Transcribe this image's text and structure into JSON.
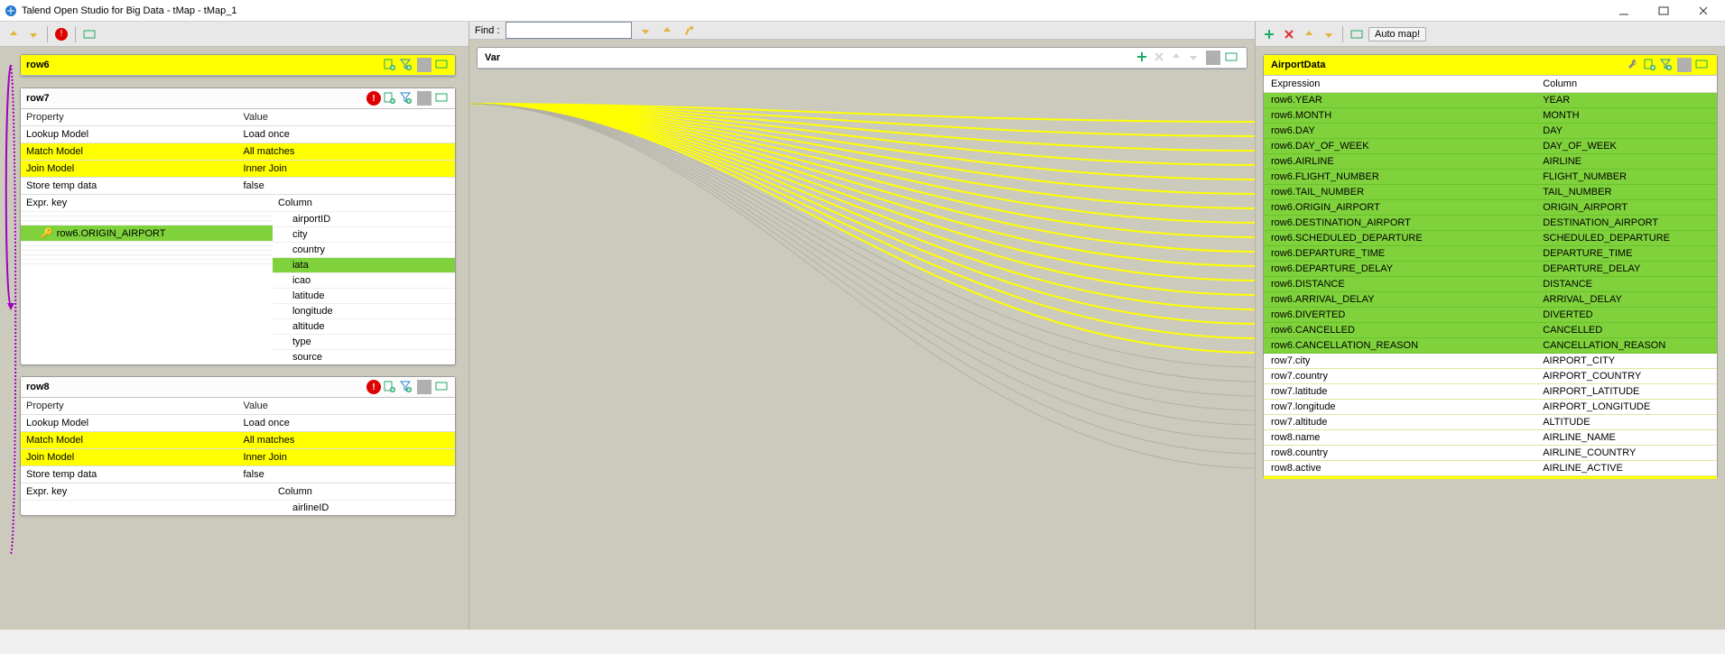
{
  "title": "Talend Open Studio for Big Data - tMap - tMap_1",
  "find_label": "Find :",
  "var_label": "Var",
  "automap_label": "Auto map!",
  "input": {
    "row6": {
      "name": "row6"
    },
    "row7": {
      "name": "row7",
      "prop_head": {
        "property": "Property",
        "value": "Value"
      },
      "props": [
        {
          "k": "Lookup Model",
          "v": "Load once",
          "hl": false
        },
        {
          "k": "Match Model",
          "v": "All matches",
          "hl": true
        },
        {
          "k": "Join Model",
          "v": "Inner Join",
          "hl": true
        },
        {
          "k": "Store temp data",
          "v": "false",
          "hl": false
        }
      ],
      "col_head_left": "Expr. key",
      "col_head_right": "Column",
      "columns": [
        {
          "k": "",
          "c": "airportID"
        },
        {
          "k": "",
          "c": "city"
        },
        {
          "k": "",
          "c": "country"
        },
        {
          "k": "row6.ORIGIN_AIRPORT",
          "c": "iata",
          "green": true,
          "key": true
        },
        {
          "k": "",
          "c": "icao"
        },
        {
          "k": "",
          "c": "latitude"
        },
        {
          "k": "",
          "c": "longitude"
        },
        {
          "k": "",
          "c": "altitude"
        },
        {
          "k": "",
          "c": "type"
        },
        {
          "k": "",
          "c": "source"
        }
      ]
    },
    "row8": {
      "name": "row8",
      "prop_head": {
        "property": "Property",
        "value": "Value"
      },
      "props": [
        {
          "k": "Lookup Model",
          "v": "Load once",
          "hl": false
        },
        {
          "k": "Match Model",
          "v": "All matches",
          "hl": true
        },
        {
          "k": "Join Model",
          "v": "Inner Join",
          "hl": true
        },
        {
          "k": "Store temp data",
          "v": "false",
          "hl": false
        }
      ],
      "col_head_left": "Expr. key",
      "col_head_right": "Column",
      "columns": [
        {
          "k": "",
          "c": "airlineID"
        }
      ]
    }
  },
  "output": {
    "name": "AirportData",
    "head_expr": "Expression",
    "head_col": "Column",
    "rows": [
      {
        "e": "row6.YEAR",
        "c": "YEAR",
        "green": true
      },
      {
        "e": "row6.MONTH",
        "c": "MONTH",
        "green": true
      },
      {
        "e": "row6.DAY",
        "c": "DAY",
        "green": true
      },
      {
        "e": "row6.DAY_OF_WEEK",
        "c": "DAY_OF_WEEK",
        "green": true
      },
      {
        "e": "row6.AIRLINE",
        "c": "AIRLINE",
        "green": true
      },
      {
        "e": "row6.FLIGHT_NUMBER",
        "c": "FLIGHT_NUMBER",
        "green": true
      },
      {
        "e": "row6.TAIL_NUMBER",
        "c": "TAIL_NUMBER",
        "green": true
      },
      {
        "e": "row6.ORIGIN_AIRPORT",
        "c": "ORIGIN_AIRPORT",
        "green": true
      },
      {
        "e": "row6.DESTINATION_AIRPORT",
        "c": "DESTINATION_AIRPORT",
        "green": true
      },
      {
        "e": "row6.SCHEDULED_DEPARTURE",
        "c": "SCHEDULED_DEPARTURE",
        "green": true
      },
      {
        "e": "row6.DEPARTURE_TIME",
        "c": "DEPARTURE_TIME",
        "green": true
      },
      {
        "e": "row6.DEPARTURE_DELAY",
        "c": "DEPARTURE_DELAY",
        "green": true
      },
      {
        "e": "row6.DISTANCE",
        "c": "DISTANCE",
        "green": true
      },
      {
        "e": "row6.ARRIVAL_DELAY",
        "c": "ARRIVAL_DELAY",
        "green": true
      },
      {
        "e": "row6.DIVERTED",
        "c": "DIVERTED",
        "green": true
      },
      {
        "e": "row6.CANCELLED",
        "c": "CANCELLED",
        "green": true
      },
      {
        "e": "row6.CANCELLATION_REASON",
        "c": "CANCELLATION_REASON",
        "green": true
      },
      {
        "e": "row7.city",
        "c": "AIRPORT_CITY",
        "green": false
      },
      {
        "e": "row7.country",
        "c": "AIRPORT_COUNTRY",
        "green": false
      },
      {
        "e": "row7.latitude",
        "c": "AIRPORT_LATITUDE",
        "green": false
      },
      {
        "e": "row7.longitude",
        "c": "AIRPORT_LONGITUDE",
        "green": false
      },
      {
        "e": "row7.altitude",
        "c": "ALTITUDE",
        "green": false
      },
      {
        "e": "row8.name",
        "c": "AIRLINE_NAME",
        "green": false
      },
      {
        "e": "row8.country",
        "c": "AIRLINE_COUNTRY",
        "green": false
      },
      {
        "e": "row8.active",
        "c": "AIRLINE_ACTIVE",
        "green": false
      }
    ]
  }
}
